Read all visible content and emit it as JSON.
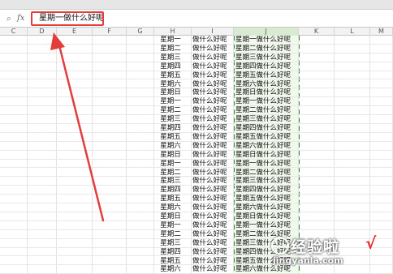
{
  "formula_bar": {
    "zoom_icon": "magnifier-icon",
    "fx_label": "fx",
    "content": "星期一做什么好呢"
  },
  "columns": [
    "C",
    "D",
    "E",
    "F",
    "G",
    "H",
    "I",
    "J",
    "K",
    "L",
    "M"
  ],
  "active_column": "J",
  "rows": [
    {
      "h": "星期一",
      "i": "做什么好呢",
      "j": "星期一做什么好呢"
    },
    {
      "h": "星期二",
      "i": "做什么好呢",
      "j": "星期二做什么好呢"
    },
    {
      "h": "星期三",
      "i": "做什么好呢",
      "j": "星期三做什么好呢"
    },
    {
      "h": "星期四",
      "i": "做什么好呢",
      "j": "星期四做什么好呢"
    },
    {
      "h": "星期五",
      "i": "做什么好呢",
      "j": "星期五做什么好呢"
    },
    {
      "h": "星期六",
      "i": "做什么好呢",
      "j": "星期六做什么好呢"
    },
    {
      "h": "星期日",
      "i": "做什么好呢",
      "j": "星期日做什么好呢"
    },
    {
      "h": "星期一",
      "i": "做什么好呢",
      "j": "星期一做什么好呢"
    },
    {
      "h": "星期二",
      "i": "做什么好呢",
      "j": "星期二做什么好呢"
    },
    {
      "h": "星期三",
      "i": "做什么好呢",
      "j": "星期三做什么好呢"
    },
    {
      "h": "星期四",
      "i": "做什么好呢",
      "j": "星期四做什么好呢"
    },
    {
      "h": "星期五",
      "i": "做什么好呢",
      "j": "星期五做什么好呢"
    },
    {
      "h": "星期六",
      "i": "做什么好呢",
      "j": "星期六做什么好呢"
    },
    {
      "h": "星期日",
      "i": "做什么好呢",
      "j": "星期日做什么好呢"
    },
    {
      "h": "星期一",
      "i": "做什么好呢",
      "j": "星期一做什么好呢"
    },
    {
      "h": "星期二",
      "i": "做什么好呢",
      "j": "星期二做什么好呢"
    },
    {
      "h": "星期三",
      "i": "做什么好呢",
      "j": "星期三做什么好呢"
    },
    {
      "h": "星期四",
      "i": "做什么好呢",
      "j": "星期四做什么好呢"
    },
    {
      "h": "星期五",
      "i": "做什么好呢",
      "j": "星期五做什么好呢"
    },
    {
      "h": "星期六",
      "i": "做什么好呢",
      "j": "星期六做什么好呢"
    },
    {
      "h": "星期日",
      "i": "做什么好呢",
      "j": "星期日做什么好呢"
    },
    {
      "h": "星期一",
      "i": "做什么好呢",
      "j": "星期一做什么好呢"
    },
    {
      "h": "星期二",
      "i": "做什么好呢",
      "j": "星期二做什么好呢"
    },
    {
      "h": "星期三",
      "i": "做什么好呢",
      "j": "星期三做什么好呢"
    },
    {
      "h": "星期四",
      "i": "做什么好呢",
      "j": "星期四做什么好呢"
    },
    {
      "h": "星期五",
      "i": "做什么好呢",
      "j": "星期五做什么好呢"
    },
    {
      "h": "星期六",
      "i": "做什么好呢",
      "j": "星期六做什么好呢"
    }
  ],
  "watermark": {
    "title": "经验啦",
    "check": "√",
    "url": "jingyanla.com"
  },
  "colors": {
    "highlight_red": "#e43c3c",
    "selection_green": "#2f8a2f"
  }
}
